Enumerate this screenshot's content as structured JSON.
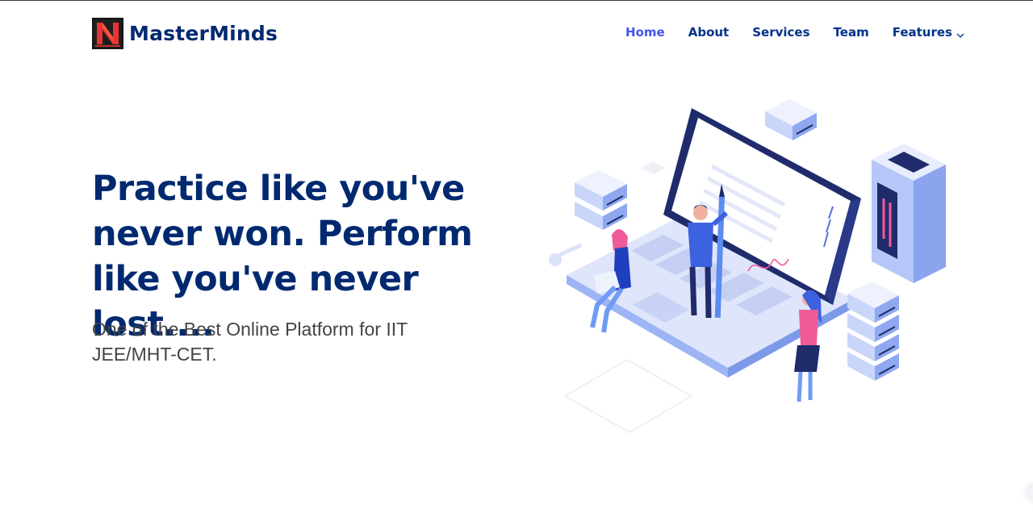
{
  "brand": {
    "name": "MasterMinds",
    "colors": {
      "primary": "#012970",
      "accent": "#4154f1",
      "logo_red": "#e63434"
    }
  },
  "nav": {
    "items": [
      {
        "label": "Home",
        "active": true
      },
      {
        "label": "About",
        "active": false
      },
      {
        "label": "Services",
        "active": false
      },
      {
        "label": "Team",
        "active": false
      },
      {
        "label": "Features",
        "active": false,
        "icon": "chevron-down-icon"
      }
    ]
  },
  "hero": {
    "title": "Practice like you've never won. Perform like you've never lost....",
    "subtitle": "One of the Best Online Platform for IIT JEE/MHT-CET."
  },
  "illustration": {
    "icon": "laptop-people-illustration"
  }
}
